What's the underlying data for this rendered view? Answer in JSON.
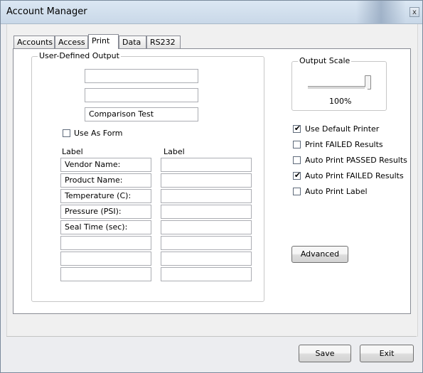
{
  "window": {
    "title": "Account Manager",
    "close_glyph": "x"
  },
  "tabs": [
    {
      "label": "Accounts",
      "active": false
    },
    {
      "label": "Access",
      "active": false
    },
    {
      "label": "Print",
      "active": true
    },
    {
      "label": "Data",
      "active": false
    },
    {
      "label": "RS232",
      "active": false
    }
  ],
  "user_defined_output": {
    "legend": "User-Defined Output",
    "lines": [
      "",
      "",
      "Comparison Test"
    ],
    "use_as_form": {
      "label": "Use As Form",
      "checked": false
    },
    "label_header_left": "Label",
    "label_header_right": "Label",
    "left_labels": [
      "Vendor Name:",
      "Product Name:",
      "Temperature (C):",
      "Pressure (PSI):",
      "Seal Time (sec):",
      "",
      "",
      ""
    ],
    "right_labels": [
      "",
      "",
      "",
      "",
      "",
      "",
      "",
      ""
    ]
  },
  "output_scale": {
    "legend": "Output Scale",
    "value_text": "100%",
    "level_percent": 100
  },
  "options": [
    {
      "label": "Use Default Printer",
      "checked": true
    },
    {
      "label": "Print FAILED Results",
      "checked": false
    },
    {
      "label": "Auto Print PASSED Results",
      "checked": false
    },
    {
      "label": "Auto Print FAILED Results",
      "checked": true
    },
    {
      "label": "Auto Print Label",
      "checked": false
    }
  ],
  "advanced_label": "Advanced",
  "footer": {
    "save_label": "Save",
    "exit_label": "Exit"
  },
  "check_glyph": "✔"
}
